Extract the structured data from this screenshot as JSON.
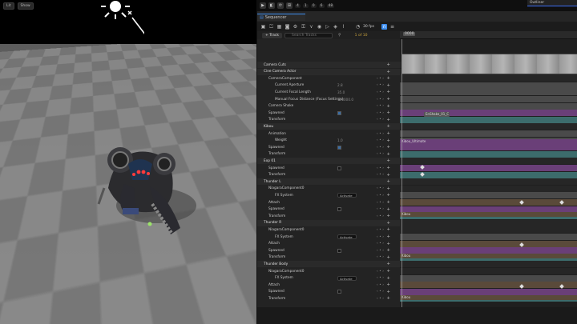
{
  "viewport": {
    "lit_label": "Lit",
    "show_label": "Show"
  },
  "top_bar": {
    "badges": [
      "4",
      "1",
      "0",
      "6",
      "48"
    ],
    "outliner_tab": "Outliner"
  },
  "sequencer": {
    "tab_label": "Sequencer",
    "fps": "30 fps",
    "track_button": "+ Track",
    "search_placeholder": "Search Tracks",
    "frame_count": "1 of 10",
    "time_marker": "0000"
  },
  "tree_rows": [
    {
      "label": "Camera Cuts",
      "indent": 8,
      "type": "header"
    },
    {
      "label": "Cine Camera Actor",
      "indent": 8,
      "type": "header"
    },
    {
      "label": "CameraComponent",
      "indent": 14,
      "type": "sub"
    },
    {
      "label": "Current Aperture",
      "indent": 22,
      "type": "value",
      "value": "2.8"
    },
    {
      "label": "Current Focal Length",
      "indent": 22,
      "type": "value",
      "value": "35.0"
    },
    {
      "label": "Manual Focus Distance (Focus Settings)",
      "indent": 22,
      "type": "value",
      "value": "100000.0"
    },
    {
      "label": "Camera Shake",
      "indent": 14,
      "type": "plain"
    },
    {
      "label": "Spawned",
      "indent": 14,
      "type": "check",
      "on": true
    },
    {
      "label": "Transform",
      "indent": 14,
      "type": "plain"
    },
    {
      "label": "Kibou",
      "indent": 8,
      "type": "header"
    },
    {
      "label": "Animation",
      "indent": 14,
      "type": "plain"
    },
    {
      "label": "Weight",
      "indent": 22,
      "type": "value",
      "value": "1.0"
    },
    {
      "label": "Spawned",
      "indent": 14,
      "type": "check",
      "on": true
    },
    {
      "label": "Transform",
      "indent": 14,
      "type": "plain"
    },
    {
      "label": "Exp 01",
      "indent": 8,
      "type": "header"
    },
    {
      "label": "Spawned",
      "indent": 14,
      "type": "check",
      "on": false
    },
    {
      "label": "Transform",
      "indent": 14,
      "type": "plain"
    },
    {
      "label": "Thunder L",
      "indent": 8,
      "type": "header"
    },
    {
      "label": "NiagaraComponent0",
      "indent": 14,
      "type": "sub"
    },
    {
      "label": "FX System",
      "indent": 22,
      "type": "dd",
      "value": "Activate"
    },
    {
      "label": "Attach",
      "indent": 14,
      "type": "plain"
    },
    {
      "label": "Spawned",
      "indent": 14,
      "type": "check",
      "on": false
    },
    {
      "label": "Transform",
      "indent": 14,
      "type": "plain"
    },
    {
      "label": "Thunder R",
      "indent": 8,
      "type": "header"
    },
    {
      "label": "NiagaraComponent0",
      "indent": 14,
      "type": "sub"
    },
    {
      "label": "FX System",
      "indent": 22,
      "type": "dd",
      "value": "Activate"
    },
    {
      "label": "Attach",
      "indent": 14,
      "type": "plain"
    },
    {
      "label": "Spawned",
      "indent": 14,
      "type": "check",
      "on": false
    },
    {
      "label": "Transform",
      "indent": 14,
      "type": "plain"
    },
    {
      "label": "Thunder Body",
      "indent": 8,
      "type": "header"
    },
    {
      "label": "NiagaraComponent0",
      "indent": 14,
      "type": "sub"
    },
    {
      "label": "FX System",
      "indent": 22,
      "type": "dd",
      "value": "Activate"
    },
    {
      "label": "Attach",
      "indent": 14,
      "type": "plain"
    },
    {
      "label": "Spawned",
      "indent": 14,
      "type": "check",
      "on": false
    },
    {
      "label": "Transform",
      "indent": 14,
      "type": "plain"
    }
  ],
  "timeline_labels": {
    "shake_section": "EnShake_01_C",
    "anim_section": "Kibou_Ultimate",
    "kibou_a": "Kibou",
    "kibou_b": "Kibou",
    "kibou_c": "Kibou"
  },
  "colors": {
    "accent": "#3d8ef0",
    "teal_track": "#3c6c6c",
    "purple_track": "#6a3f78",
    "brown_track": "#5a4a3a",
    "grey_track": "#4a4a4a"
  }
}
